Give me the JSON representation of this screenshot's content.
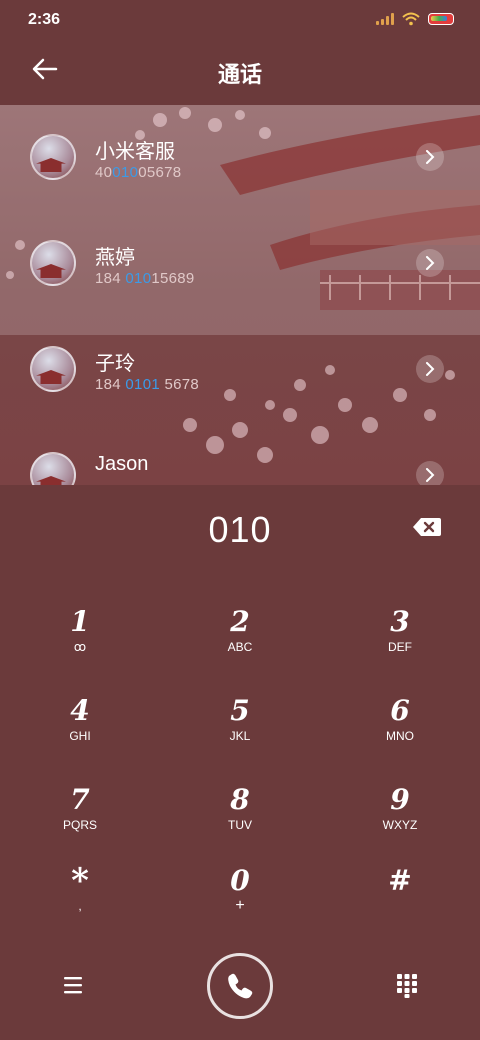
{
  "status": {
    "time": "2:36"
  },
  "header": {
    "title": "通话"
  },
  "contacts": [
    {
      "name": "小米客服",
      "num_pre": "40",
      "num_hl": "010",
      "num_post": "05678"
    },
    {
      "name": "燕婷",
      "num_pre": "184 ",
      "num_hl": "010",
      "num_post": "15689"
    },
    {
      "name": "子玲",
      "num_pre": "184 ",
      "num_hl": "0101",
      "num_post": " 5678"
    },
    {
      "name": "Jason",
      "num_pre": "",
      "num_hl": "",
      "num_post": ""
    }
  ],
  "dialer": {
    "number": "010"
  },
  "keys": [
    {
      "digit": "1",
      "letters": "ꝏ"
    },
    {
      "digit": "2",
      "letters": "ABC"
    },
    {
      "digit": "3",
      "letters": "DEF"
    },
    {
      "digit": "4",
      "letters": "GHI"
    },
    {
      "digit": "5",
      "letters": "JKL"
    },
    {
      "digit": "6",
      "letters": "MNO"
    },
    {
      "digit": "7",
      "letters": "PQRS"
    },
    {
      "digit": "8",
      "letters": "TUV"
    },
    {
      "digit": "9",
      "letters": "WXYZ"
    },
    {
      "digit": "*",
      "letters": ","
    },
    {
      "digit": "0",
      "letters": "+"
    },
    {
      "digit": "#",
      "letters": ""
    }
  ],
  "colors": {
    "background": "#6b3a3b",
    "highlight": "#3b9be8"
  }
}
